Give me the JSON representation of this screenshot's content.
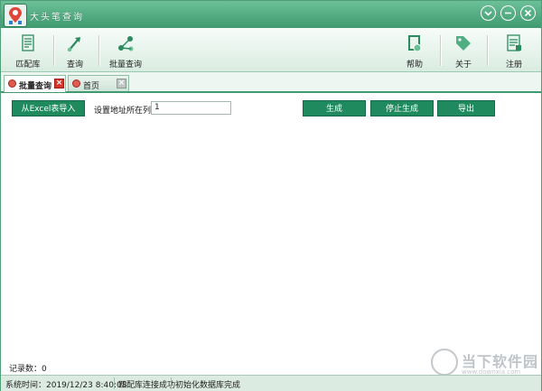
{
  "window": {
    "title": "大头笔查询",
    "controls": {
      "collapse_icon": "chevron-down-icon",
      "minimize_icon": "minimize-icon",
      "close_icon": "close-icon"
    }
  },
  "toolbar": {
    "left": [
      {
        "label": "匹配库",
        "icon": "database-icon"
      },
      {
        "label": "查询",
        "icon": "arrow-query-icon"
      },
      {
        "label": "批量查询",
        "icon": "batch-query-icon"
      }
    ],
    "right": [
      {
        "label": "帮助",
        "icon": "help-book-icon"
      },
      {
        "label": "关于",
        "icon": "tag-icon"
      },
      {
        "label": "注册",
        "icon": "register-icon"
      }
    ]
  },
  "tabs": [
    {
      "label": "批量查询",
      "active": true
    },
    {
      "label": "首页",
      "active": false
    }
  ],
  "batch": {
    "import_button": "从Excel表导入",
    "address_column_label": "设置地址所在列",
    "address_column_value": "1",
    "generate_button": "生成",
    "stop_button": "停止生成",
    "export_button": "导出"
  },
  "records": {
    "label": "记录数：0"
  },
  "status": {
    "time": "系统时间：2019/12/23 8:40:08",
    "db": "匹配库连接成功",
    "init": "初始化数据库完成"
  },
  "watermark": {
    "name": "当下软件园",
    "url": "www.downxia.com"
  },
  "colors": {
    "accent": "#1f8a5e",
    "titlebar": "#4fae82",
    "status_bg": "#dcebe2"
  }
}
